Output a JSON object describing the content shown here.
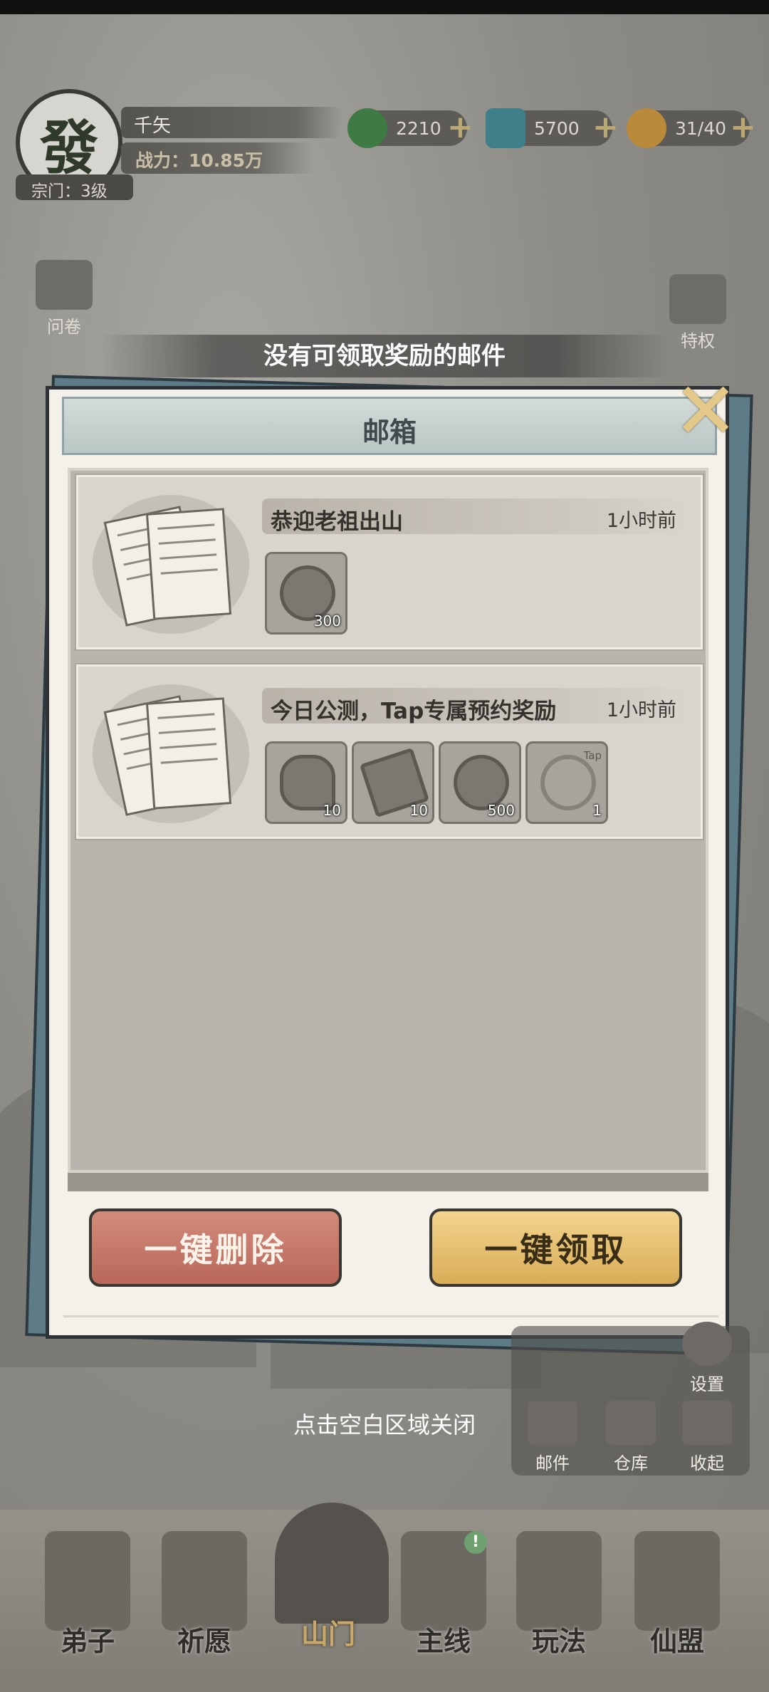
{
  "player": {
    "avatar_char": "發",
    "name": "千矢",
    "power": "战力：10.85万",
    "sect_level": "宗门：3级"
  },
  "resources": [
    {
      "icon": "jade-coin-icon",
      "value": "2210",
      "color": "#3f7a45"
    },
    {
      "icon": "crystal-icon",
      "value": "5700",
      "color": "#3f7f8a"
    },
    {
      "icon": "gourd-icon",
      "value": "31/40",
      "color": "#b88a3a"
    }
  ],
  "side_left": {
    "survey_label": "问卷"
  },
  "side_right": {
    "privilege_label": "特权"
  },
  "toast": "没有可领取奖励的邮件",
  "mailbox": {
    "title": "邮箱",
    "mails": [
      {
        "title": "恭迎老祖出山",
        "time": "1小时前",
        "rewards": [
          {
            "icon": "jade-coin-icon",
            "qty": "300"
          }
        ]
      },
      {
        "title": "今日公测，Tap专属预约奖励",
        "time": "1小时前",
        "rewards": [
          {
            "icon": "key-icon",
            "qty": "10"
          },
          {
            "icon": "scroll-icon",
            "qty": "10"
          },
          {
            "icon": "jade-coin-icon",
            "qty": "500"
          },
          {
            "icon": "tap-frame-icon",
            "qty": "1",
            "badge": "Tap"
          }
        ]
      }
    ],
    "delete_all": "一键删除",
    "claim_all": "一键领取"
  },
  "close_hint": "点击空白区域关闭",
  "corner_menu": {
    "settings": "设置",
    "mail": "邮件",
    "warehouse": "仓库",
    "collapse": "收起"
  },
  "nav": [
    {
      "label": "弟子"
    },
    {
      "label": "祈愿"
    },
    {
      "label": "山门"
    },
    {
      "label": "主线",
      "badge": "!"
    },
    {
      "label": "玩法"
    },
    {
      "label": "仙盟"
    }
  ]
}
